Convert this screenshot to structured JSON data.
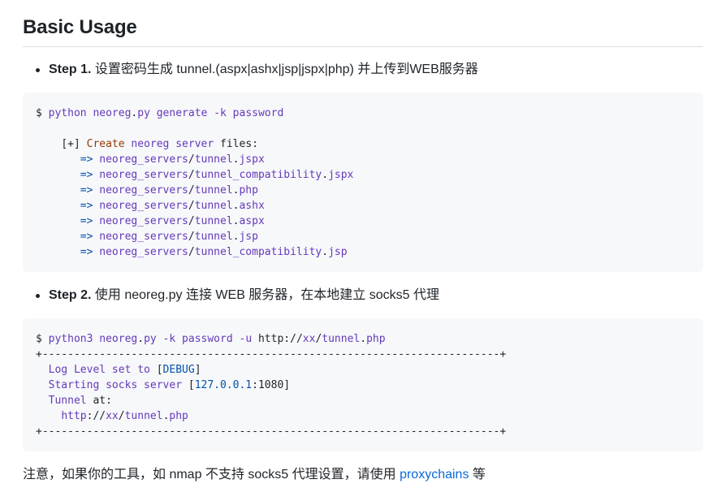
{
  "heading": "Basic Usage",
  "step1": {
    "label": "Step 1.",
    "text": " 设置密码生成 tunnel.(aspx|ashx|jsp|jspx|php) 并上传到WEB服务器"
  },
  "code1": {
    "cmd": {
      "prompt": "$ ",
      "python": "python",
      "neoreg": "neoreg",
      "dot": ".",
      "py": "py",
      "generate": "generate",
      "flag": "-k",
      "password": "password"
    },
    "created_open": "[+] ",
    "created_word": "Create",
    "created_neoreg": "neoreg",
    "created_server": "server",
    "created_files": "files:",
    "arrow": "=>",
    "files": [
      {
        "dir": "neoreg_servers",
        "name": "tunnel",
        "ext": "jspx"
      },
      {
        "dir": "neoreg_servers",
        "name": "tunnel_compatibility",
        "ext": "jspx"
      },
      {
        "dir": "neoreg_servers",
        "name": "tunnel",
        "ext": "php"
      },
      {
        "dir": "neoreg_servers",
        "name": "tunnel",
        "ext": "ashx"
      },
      {
        "dir": "neoreg_servers",
        "name": "tunnel",
        "ext": "aspx"
      },
      {
        "dir": "neoreg_servers",
        "name": "tunnel",
        "ext": "jsp"
      },
      {
        "dir": "neoreg_servers",
        "name": "tunnel_compatibility",
        "ext": "jsp"
      }
    ]
  },
  "step2": {
    "label": "Step 2.",
    "text": " 使用 neoreg.py 连接 WEB 服务器，在本地建立 socks5 代理"
  },
  "code2": {
    "prompt": "$ ",
    "python3": "python3",
    "neoreg": "neoreg",
    "py": "py",
    "flag_k": "-k",
    "password": "password",
    "flag_u": "-u",
    "http": "http",
    "url_sep": "://",
    "xx": "xx",
    "tunnel": "tunnel",
    "php": "php",
    "border": "+------------------------------------------------------------------------+",
    "log": "Log Level set to",
    "debug": "DEBUG",
    "starting": "Starting socks server",
    "ip": "127.0.0.1",
    "port": "1080",
    "tunnel_at": "Tunnel",
    "at": "at:"
  },
  "note": {
    "text": "注意，如果你的工具，如 nmap 不支持 socks5 代理设置，请使用 ",
    "link": "proxychains",
    "suffix": " 等"
  },
  "colors": {
    "purple": "#6639ba",
    "blue": "#0550ae",
    "red": "#953800",
    "link": "#0969da",
    "code_bg": "#f6f8fa"
  }
}
